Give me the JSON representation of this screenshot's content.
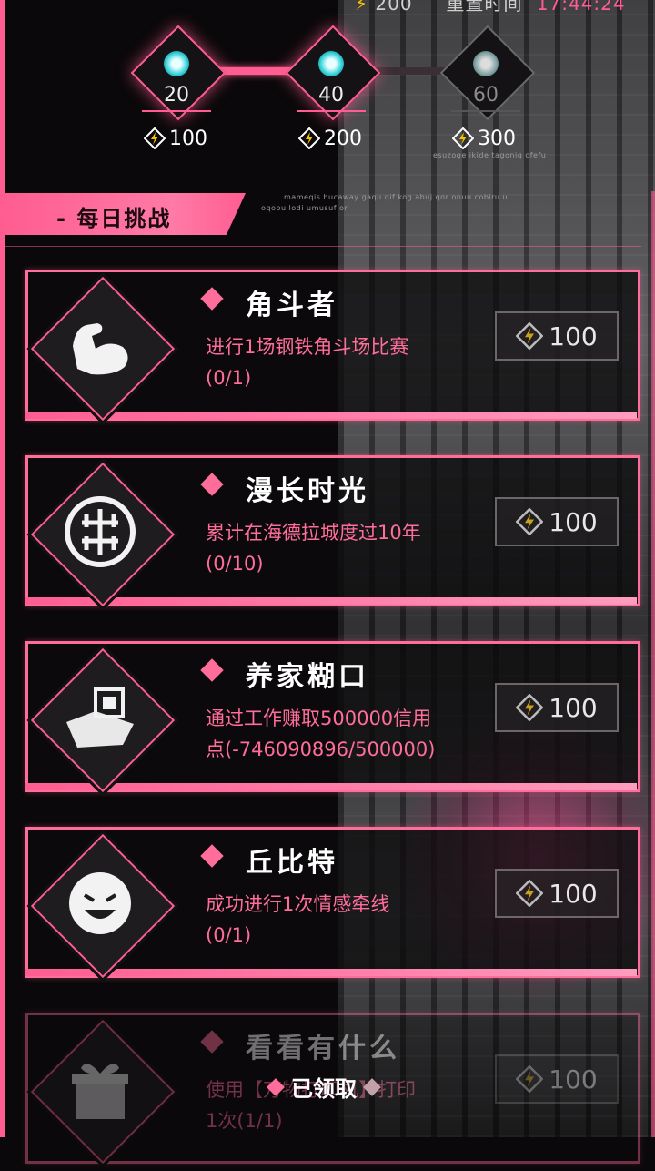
{
  "top_status": {
    "points": "200",
    "label": "重置时间",
    "time": "17:44:24"
  },
  "milestones": [
    {
      "value": "20",
      "reward": "100",
      "achieved": true
    },
    {
      "value": "40",
      "reward": "200",
      "achieved": true
    },
    {
      "value": "60",
      "reward": "300",
      "achieved": false
    }
  ],
  "milestone_progress": 0.5,
  "section": {
    "title": "- 每日挑战"
  },
  "deco": {
    "line1": "esuzoge ikide tagoniq ofefu",
    "line2": "mameqis hucaway gaqu qif kog abuj qor onun cobiru u",
    "line3": "oqobu lodi umusuf or"
  },
  "tasks": [
    {
      "title": "角斗者",
      "desc": "进行1场钢铁角斗场比赛",
      "progress": "(0/1)",
      "reward": "100",
      "icon": "muscle-arm-icon"
    },
    {
      "title": "漫长时光",
      "desc": "累计在海德拉城度过10年",
      "progress": "(0/10)",
      "reward": "100",
      "icon": "longevity-seal-icon"
    },
    {
      "title": "养家糊口",
      "desc": "通过工作赚取500000信用",
      "progress": "点(-746090896/500000)",
      "reward": "100",
      "icon": "chip-card-icon"
    },
    {
      "title": "丘比特",
      "desc": "成功进行1次情感牵线",
      "progress": "(0/1)",
      "reward": "100",
      "icon": "laughing-face-icon"
    },
    {
      "title": "看看有什么",
      "desc": "使用【万物打印机】打印",
      "progress": "1次(1/1)",
      "reward": "100",
      "icon": "gift-box-icon"
    }
  ],
  "claimed_label": "已领取",
  "colors": {
    "accent": "#ff5d92",
    "text_accent": "#ff6d9a"
  }
}
